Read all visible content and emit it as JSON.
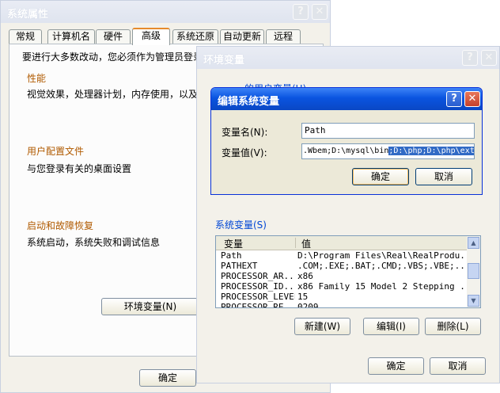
{
  "sysprops": {
    "title": "系统属性",
    "tabs": [
      {
        "label": "常规"
      },
      {
        "label": "计算机名"
      },
      {
        "label": "硬件"
      },
      {
        "label": "高级"
      },
      {
        "label": "系统还原"
      },
      {
        "label": "自动更新"
      },
      {
        "label": "远程"
      }
    ],
    "admin_note": "要进行大多数改动，您必须作为管理员登录",
    "performance": {
      "title": "性能",
      "desc": "视觉效果，处理器计划，内存使用，以及"
    },
    "user_profile": {
      "title": "用户配置文件",
      "desc": "与您登录有关的桌面设置"
    },
    "startup": {
      "title": "启动和故障恢复",
      "desc": "系统启动，系统失败和调试信息"
    },
    "env_button": "环境变量(N)",
    "ok_button": "确定"
  },
  "envvars": {
    "title": "环境变量",
    "user_vars_label": "的用户变量(U)",
    "system_vars_label": "系统变量(S)",
    "columns": [
      "变量",
      "值"
    ],
    "rows": [
      {
        "name": "Path",
        "value": "D:\\Program Files\\Real\\RealProdu..."
      },
      {
        "name": "PATHEXT",
        "value": ".COM;.EXE;.BAT;.CMD;.VBS;.VBE;...."
      },
      {
        "name": "PROCESSOR_AR...",
        "value": "x86"
      },
      {
        "name": "PROCESSOR_ID...",
        "value": "x86 Family 15 Model 2 Stepping ..."
      },
      {
        "name": "PROCESSOR_LEVEL",
        "value": "15"
      },
      {
        "name": "PROCESSOR_RE...",
        "value": "0209"
      }
    ],
    "new_button": "新建(W)",
    "edit_button": "编辑(I)",
    "delete_button": "删除(L)",
    "ok_button": "确定",
    "cancel_button": "取消"
  },
  "editvar": {
    "title": "编辑系统变量",
    "name_label": "变量名(N):",
    "name_value": "Path",
    "value_label": "变量值(V):",
    "value_prefix": ".Wbem;D:\\mysql\\bin",
    "value_selected": ";D:\\php;D:\\php\\ext",
    "ok_button": "确定",
    "cancel_button": "取消"
  },
  "colors": {
    "accent": "#0046d5",
    "selection": "#316ac5",
    "title_active": "#0a54e0"
  }
}
